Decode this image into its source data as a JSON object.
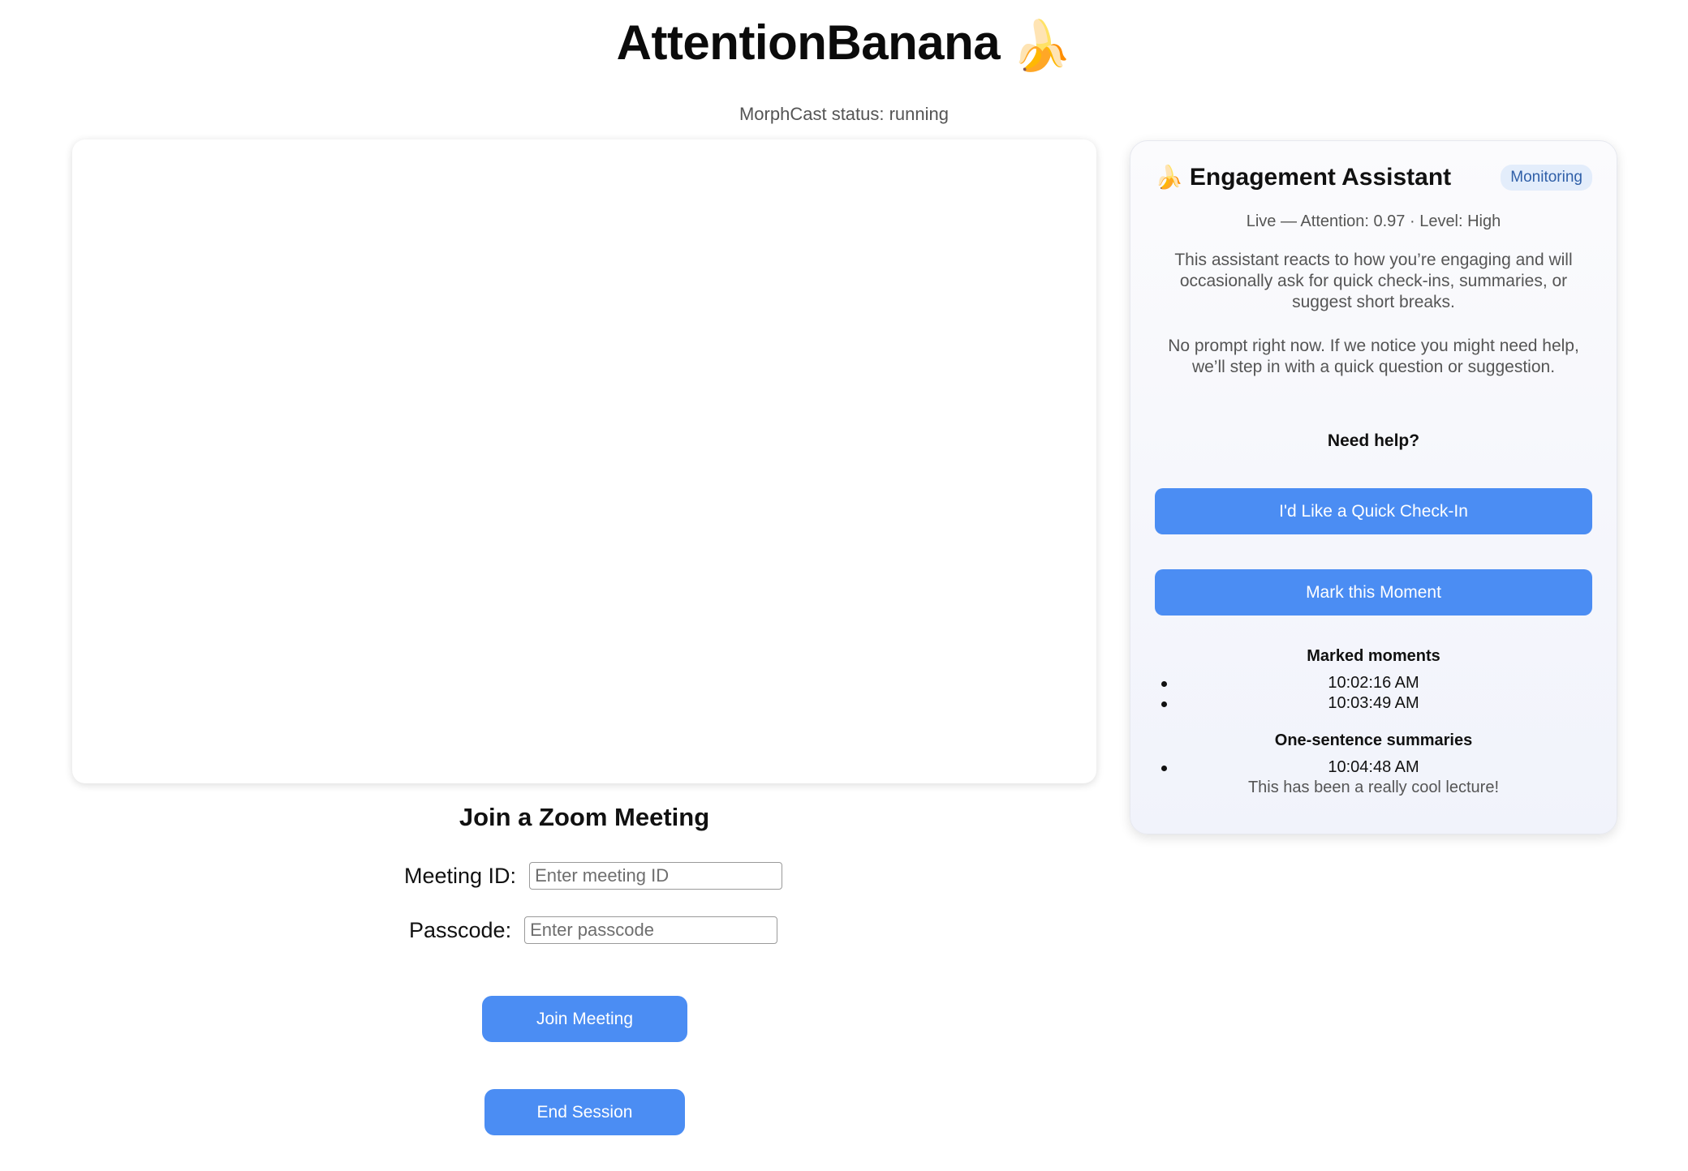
{
  "app": {
    "title": "AttentionBanana",
    "title_emoji": "🍌"
  },
  "status": {
    "text": "MorphCast status: running"
  },
  "join": {
    "heading": "Join a Zoom Meeting",
    "meeting_id_label": "Meeting ID:",
    "meeting_id_placeholder": "Enter meeting ID",
    "meeting_id_value": "",
    "passcode_label": "Passcode:",
    "passcode_placeholder": "Enter passcode",
    "passcode_value": "",
    "join_button": "Join Meeting",
    "end_button": "End Session"
  },
  "assistant": {
    "emoji": "🍌",
    "title": "Engagement Assistant",
    "badge": "Monitoring",
    "live_line": "Live — Attention: 0.97 · Level: High",
    "intro": "This assistant reacts to how you’re engaging and will occasionally ask for quick check-ins, summaries, or suggest short breaks.",
    "no_prompt": "No prompt right now. If we notice you might need help, we’ll step in with a quick question or suggestion.",
    "need_help": "Need help?",
    "checkin_button": "I'd Like a Quick Check-In",
    "mark_button": "Mark this Moment",
    "marked_title": "Marked moments",
    "marked_moments": [
      "10:02:16 AM",
      "10:03:49 AM"
    ],
    "summaries_title": "One-sentence summaries",
    "summaries": [
      {
        "time": "10:04:48 AM",
        "text": "This has been a really cool lecture!"
      }
    ]
  },
  "colors": {
    "primary_button": "#4b8df3",
    "badge_bg": "#e3edfb",
    "badge_text": "#2f5fa8"
  }
}
